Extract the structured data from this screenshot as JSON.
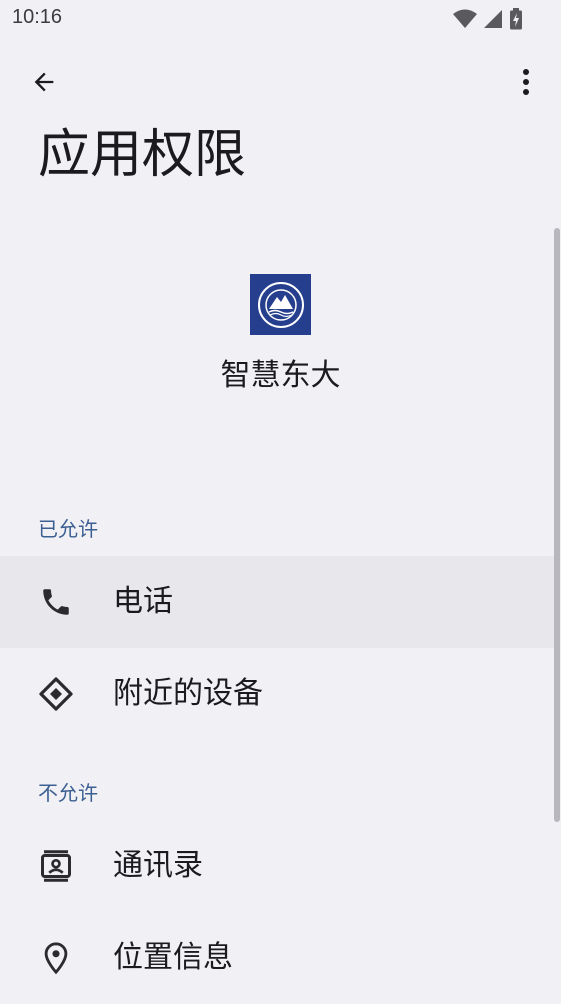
{
  "status_bar": {
    "time": "10:16",
    "icons": [
      "wifi-icon",
      "signal-icon",
      "battery-charging-icon"
    ]
  },
  "app_bar": {
    "back_icon": "arrow-back-icon",
    "more_icon": "more-vert-icon"
  },
  "page": {
    "title": "应用权限"
  },
  "app": {
    "name": "智慧东大",
    "icon": "university-logo-icon"
  },
  "sections": {
    "allowed": {
      "header": "已允许",
      "items": [
        {
          "label": "电话",
          "icon": "phone-icon"
        },
        {
          "label": "附近的设备",
          "icon": "nearby-devices-icon"
        }
      ]
    },
    "denied": {
      "header": "不允许",
      "items": [
        {
          "label": "通讯录",
          "icon": "contacts-icon"
        },
        {
          "label": "位置信息",
          "icon": "location-icon"
        }
      ]
    }
  },
  "colors": {
    "background": "#f1f0f5",
    "section_header": "#3b5f92",
    "highlight_row": "#e8e7ec",
    "app_icon_bg": "#253f8e"
  }
}
